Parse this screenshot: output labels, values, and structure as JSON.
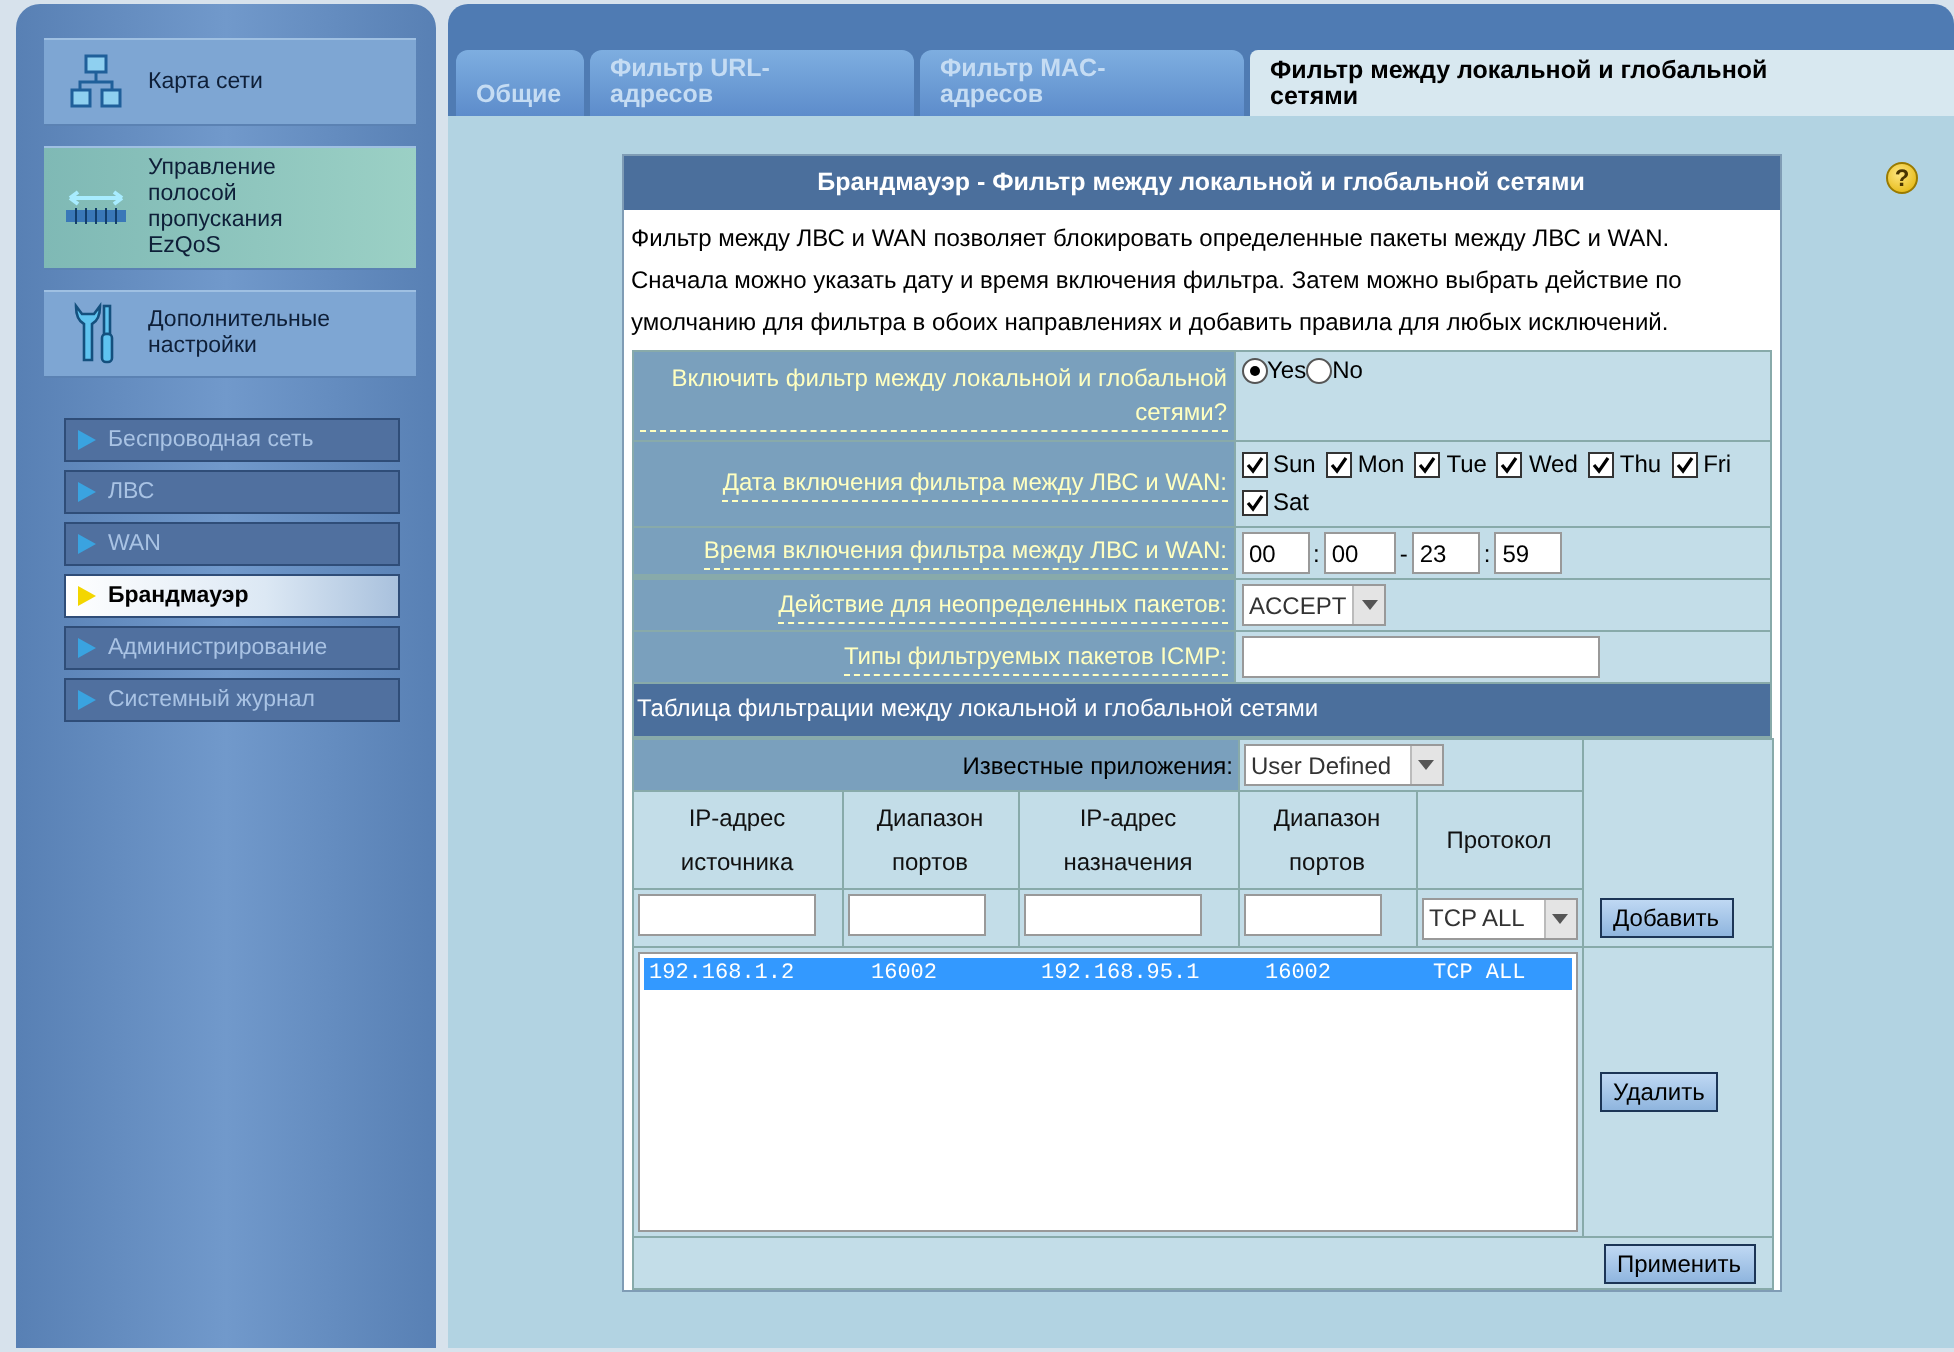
{
  "sidebar": {
    "main_items": [
      {
        "label": "Карта сети",
        "kind": "network",
        "highlighted": false
      },
      {
        "label": "Управление полосой пропускания EzQoS",
        "kind": "bandwidth",
        "highlighted": true
      },
      {
        "label": "Дополнительные настройки",
        "kind": "tools",
        "highlighted": false
      }
    ],
    "sub_items": [
      {
        "label": "Беспроводная сеть",
        "selected": false
      },
      {
        "label": "ЛВС",
        "selected": false
      },
      {
        "label": "WAN",
        "selected": false
      },
      {
        "label": "Брандмауэр",
        "selected": true
      },
      {
        "label": "Администрирование",
        "selected": false
      },
      {
        "label": "Системный журнал",
        "selected": false
      }
    ]
  },
  "tabs": [
    {
      "label": "Общие",
      "selected": false
    },
    {
      "label": "Фильтр URL-адресов",
      "selected": false
    },
    {
      "label": "Фильтр MAC-адресов",
      "selected": false
    },
    {
      "label": "Фильтр между локальной и глобальной сетями",
      "selected": true
    }
  ],
  "help_icon": "?",
  "panel": {
    "title": "Брандмауэр - Фильтр между локальной и глобальной сетями",
    "description": "Фильтр между ЛВС и WAN позволяет блокировать определенные пакеты между ЛВС и WAN. Сначала можно указать дату и время включения фильтра. Затем можно выбрать действие по умолчанию для фильтра в обоих направлениях и добавить правила для любых исключений.",
    "settings": [
      {
        "kind": "radio",
        "label": "Включить фильтр между локальной и глобальной сетями?",
        "options": [
          {
            "label": "Yes",
            "selected": true
          },
          {
            "label": "No",
            "selected": false
          }
        ]
      },
      {
        "kind": "days",
        "label": "Дата включения фильтра между ЛВС и WAN:",
        "days": [
          {
            "label": "Sun",
            "checked": true
          },
          {
            "label": "Mon",
            "checked": true
          },
          {
            "label": "Tue",
            "checked": true
          },
          {
            "label": "Wed",
            "checked": true
          },
          {
            "label": "Thu",
            "checked": true
          },
          {
            "label": "Fri",
            "checked": true
          },
          {
            "label": "Sat",
            "checked": true
          }
        ]
      },
      {
        "kind": "time",
        "label": "Время включения фильтра между ЛВС и WAN:",
        "values": [
          "00",
          "00",
          "23",
          "59"
        ],
        "separators": [
          ":",
          "-",
          ":"
        ]
      },
      {
        "kind": "select",
        "label": "Действие для неопределенных пакетов:",
        "value": "ACCEPT"
      },
      {
        "kind": "text",
        "label": "Типы фильтруемых пакетов ICMP:"
      }
    ],
    "rule_table": {
      "title": "Таблица фильтрации между локальной и глобальной сетями",
      "known_apps_label": "Известные приложения:",
      "known_apps_value": "User Defined",
      "columns": [
        "IP-адрес источника",
        "Диапазон портов",
        "IP-адрес назначения",
        "Диапазон портов",
        "Протокол"
      ],
      "protocol_value": "TCP ALL",
      "add_button": "Добавить",
      "rules": [
        {
          "cells": [
            "192.168.1.2",
            "16002",
            "192.168.95.1",
            "16002",
            "TCP ALL"
          ],
          "selected": true
        }
      ],
      "delete_button": "Удалить"
    },
    "apply_button": "Применить"
  }
}
